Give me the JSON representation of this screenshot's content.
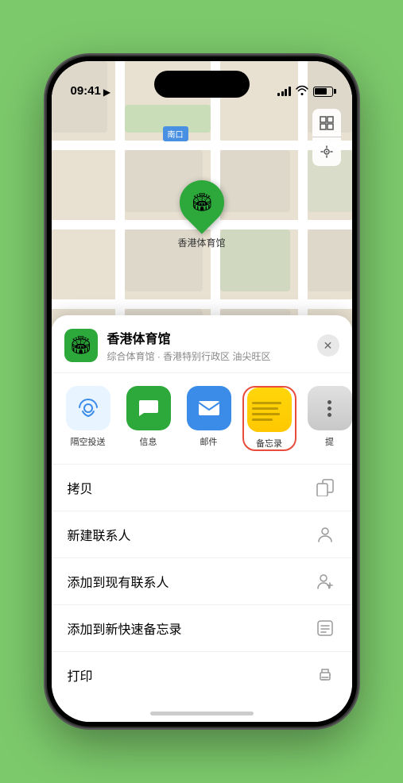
{
  "status_bar": {
    "time": "09:41",
    "location_arrow": "▸"
  },
  "map": {
    "south_gate_label": "南口",
    "venue_pin_label": "香港体育馆",
    "pin_emoji": "🏟"
  },
  "sheet": {
    "venue_icon_emoji": "🏟",
    "venue_name": "香港体育馆",
    "venue_desc": "综合体育馆 · 香港特别行政区 油尖旺区",
    "close_label": "✕"
  },
  "share_items": [
    {
      "label": "隔空投送",
      "type": "airdrop"
    },
    {
      "label": "信息",
      "type": "message"
    },
    {
      "label": "邮件",
      "type": "mail"
    },
    {
      "label": "备忘录",
      "type": "notes"
    },
    {
      "label": "提",
      "type": "more"
    }
  ],
  "menu_items": [
    {
      "label": "拷贝",
      "icon": "copy"
    },
    {
      "label": "新建联系人",
      "icon": "person"
    },
    {
      "label": "添加到现有联系人",
      "icon": "person-add"
    },
    {
      "label": "添加到新快速备忘录",
      "icon": "memo"
    },
    {
      "label": "打印",
      "icon": "print"
    }
  ]
}
